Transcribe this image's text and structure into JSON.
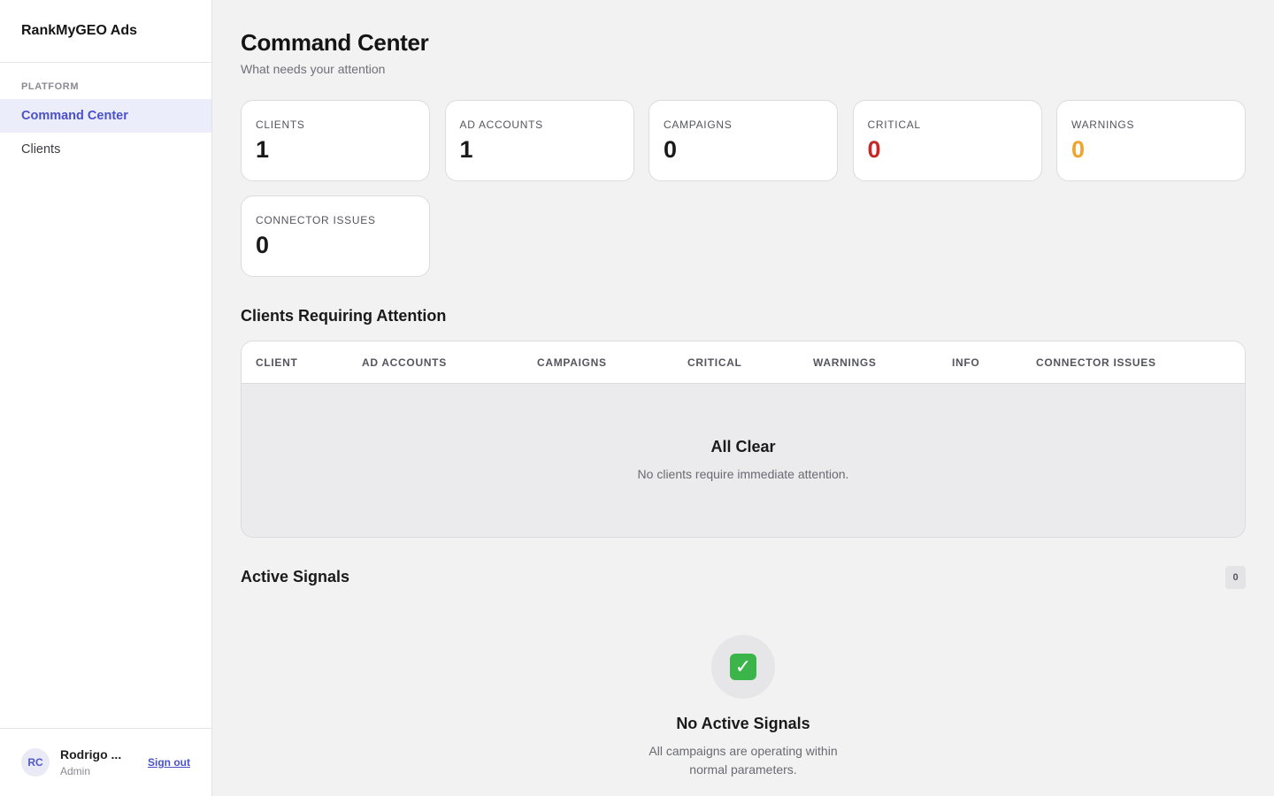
{
  "app": {
    "name": "RankMyGEO Ads"
  },
  "sidebar": {
    "section_label": "PLATFORM",
    "items": [
      {
        "label": "Command Center",
        "active": true
      },
      {
        "label": "Clients",
        "active": false
      }
    ]
  },
  "user": {
    "initials": "RC",
    "name": "Rodrigo ...",
    "role": "Admin",
    "signout_label": "Sign out"
  },
  "page": {
    "title": "Command Center",
    "subtitle": "What needs your attention"
  },
  "stats": [
    {
      "label": "CLIENTS",
      "value": "1"
    },
    {
      "label": "AD ACCOUNTS",
      "value": "1"
    },
    {
      "label": "CAMPAIGNS",
      "value": "0"
    },
    {
      "label": "CRITICAL",
      "value": "0",
      "color": "#c62828"
    },
    {
      "label": "WARNINGS",
      "value": "0",
      "color": "#f2a32c"
    },
    {
      "label": "CONNECTOR ISSUES",
      "value": "0"
    }
  ],
  "attention": {
    "title": "Clients Requiring Attention",
    "columns": [
      "CLIENT",
      "AD ACCOUNTS",
      "CAMPAIGNS",
      "CRITICAL",
      "WARNINGS",
      "INFO",
      "CONNECTOR ISSUES"
    ],
    "empty_title": "All Clear",
    "empty_message": "No clients require immediate attention."
  },
  "signals": {
    "title": "Active Signals",
    "count": "0",
    "empty_icon": "check-mark-button-icon",
    "empty_title": "No Active Signals",
    "empty_message": "All campaigns are operating within normal parameters."
  },
  "colors": {
    "accent": "#4a51c9",
    "critical": "#c62828",
    "warning": "#f2a32c",
    "success": "#3bb54a"
  }
}
